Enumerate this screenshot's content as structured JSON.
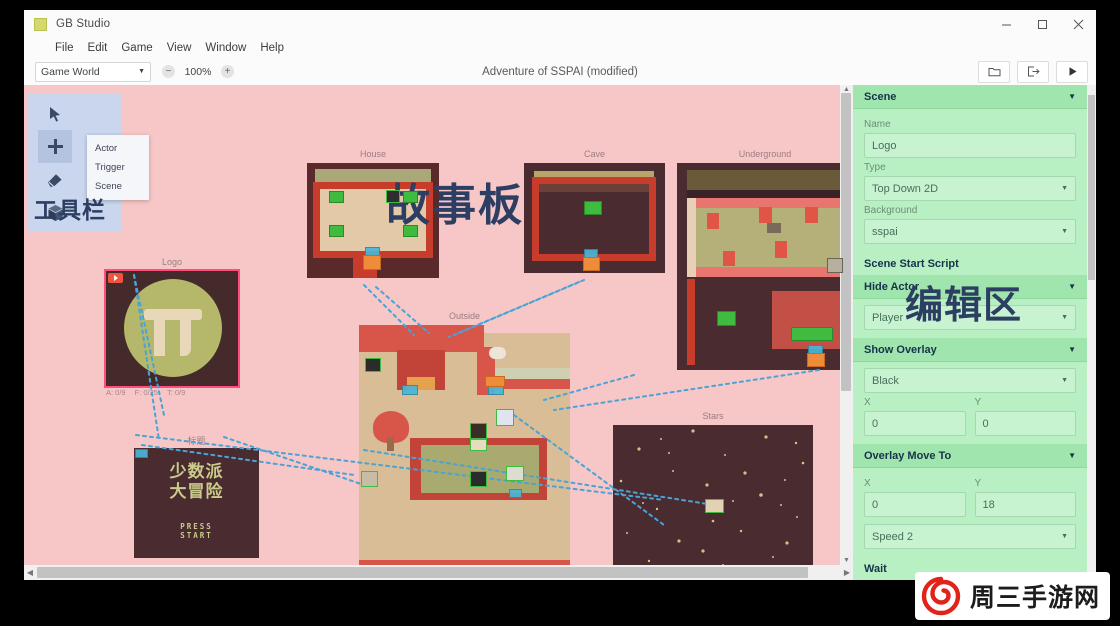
{
  "window": {
    "app_icon": "gb-studio-icon",
    "title": "GB Studio",
    "minimize": "minimize-icon",
    "maximize": "maximize-icon",
    "close": "close-icon"
  },
  "menubar": {
    "items": [
      {
        "label": "File"
      },
      {
        "label": "Edit"
      },
      {
        "label": "Game"
      },
      {
        "label": "View"
      },
      {
        "label": "Window"
      },
      {
        "label": "Help"
      }
    ]
  },
  "toolbar": {
    "world_select": "Game World",
    "zoom_out": "−",
    "zoom_value": "100%",
    "zoom_in": "+",
    "document_title": "Adventure of SSPAI (modified)",
    "open_label": "folder-icon",
    "export_label": "export-icon",
    "play_label": "play-icon"
  },
  "palette": {
    "tools": [
      {
        "name": "select-tool",
        "selected": false
      },
      {
        "name": "add-tool",
        "selected": true
      },
      {
        "name": "eraser-tool",
        "selected": false
      },
      {
        "name": "scene-tool",
        "selected": false
      }
    ],
    "menu": [
      {
        "label": "Actor"
      },
      {
        "label": "Trigger"
      },
      {
        "label": "Scene"
      }
    ],
    "annotation": "工具栏"
  },
  "annotations": {
    "storyboard": "故事板",
    "editor": "编辑区"
  },
  "scenes": [
    {
      "id": "house",
      "label": "House"
    },
    {
      "id": "cave",
      "label": "Cave"
    },
    {
      "id": "underground",
      "label": "Underground"
    },
    {
      "id": "logo",
      "label": "Logo",
      "stats": {
        "actors": "A: 0/9",
        "frames": "F: 0/25",
        "triggers": "T: 0/9"
      },
      "selected": true
    },
    {
      "id": "title",
      "label": "标题",
      "title_line1": "少数派",
      "title_line2": "大冒险",
      "press_start_line1": "PRESS",
      "press_start_line2": "START"
    },
    {
      "id": "outside",
      "label": "Outside"
    },
    {
      "id": "stars",
      "label": "Stars"
    }
  ],
  "inspector": {
    "sections": [
      {
        "id": "scene",
        "title": "Scene",
        "collapse_icon": "chevron-down-icon",
        "fields": [
          {
            "label": "Name",
            "value": "Logo",
            "type": "text"
          },
          {
            "label": "Type",
            "value": "Top Down 2D",
            "type": "select"
          },
          {
            "label": "Background",
            "value": "sspai",
            "type": "select"
          }
        ]
      },
      {
        "id": "scene-start-script",
        "title": "Scene Start Script",
        "collapse_icon": "chevron-down-icon",
        "fields": []
      },
      {
        "id": "hide-actor",
        "title": "Hide Actor",
        "collapse_icon": "chevron-down-icon",
        "fields": [
          {
            "label": "",
            "value": "Player",
            "type": "select"
          }
        ]
      },
      {
        "id": "show-overlay",
        "title": "Show Overlay",
        "collapse_icon": "chevron-down-icon",
        "fields": [
          {
            "label": "",
            "value": "Black",
            "type": "select"
          },
          {
            "label": "X",
            "value": "0",
            "type": "text"
          },
          {
            "label": "Y",
            "value": "0",
            "type": "text"
          }
        ]
      },
      {
        "id": "overlay-move-to",
        "title": "Overlay Move To",
        "collapse_icon": "chevron-down-icon",
        "fields": [
          {
            "label": "X",
            "value": "0",
            "type": "text"
          },
          {
            "label": "Y",
            "value": "18",
            "type": "text"
          },
          {
            "label": "",
            "value": "Speed 2",
            "type": "select"
          }
        ]
      },
      {
        "id": "wait",
        "title": "Wait",
        "collapse_icon": "chevron-down-icon",
        "fields": []
      }
    ]
  },
  "watermark": {
    "logo": "spiral-logo-icon",
    "text": "周三手游网"
  },
  "colors": {
    "canvas_bg": "#f7c7c7",
    "panel_bg": "#b9f0c3",
    "panel_header": "#9fe5ad",
    "accent_caption": "#2d3e63",
    "selection": "#ff4d7e",
    "actor": "#3fbb3f",
    "trigger": "#49b6d6",
    "connection": "#4aa3d6"
  }
}
